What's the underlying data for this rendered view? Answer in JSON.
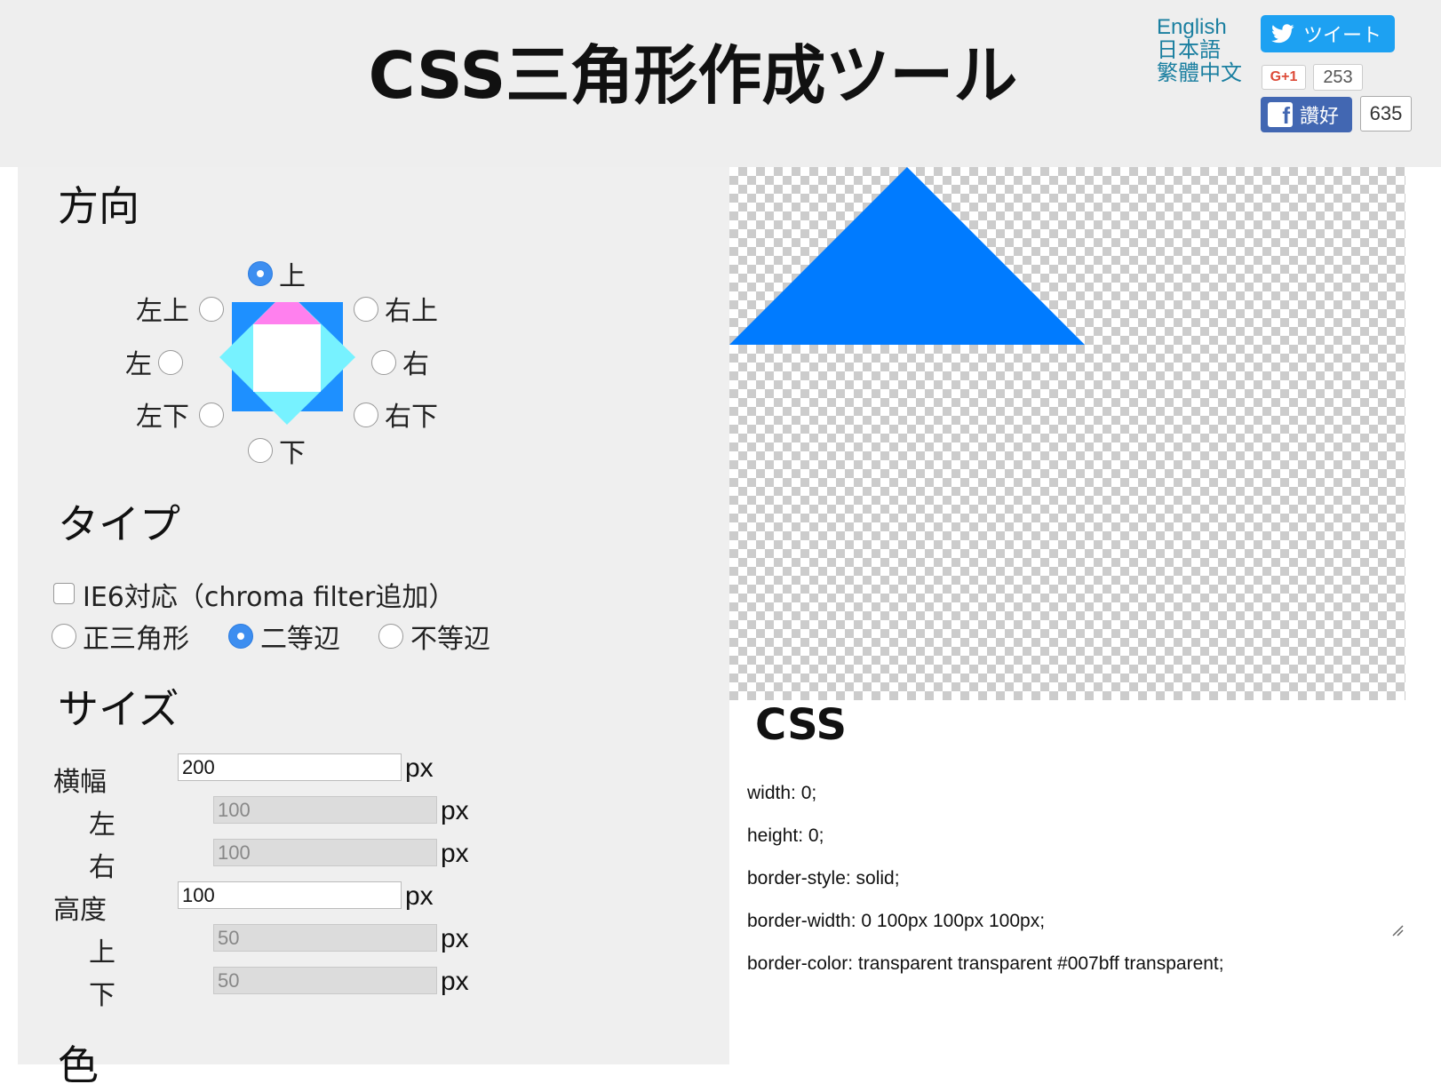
{
  "header": {
    "title": "CSS三角形作成ツール",
    "languages": [
      "English",
      "日本語",
      "繁體中文"
    ],
    "tweet_label": "ツイート",
    "gplus_label": "G+1",
    "gplus_count": "253",
    "fb_label": "讚好",
    "fb_count": "635"
  },
  "direction": {
    "heading": "方向",
    "options": {
      "up": "上",
      "up_left": "左上",
      "up_right": "右上",
      "left": "左",
      "right": "右",
      "down_left": "左下",
      "down_right": "右下",
      "down": "下"
    },
    "selected": "up"
  },
  "type": {
    "heading": "タイプ",
    "ie6_label": "IE6対応（chroma filter追加）",
    "ie6_checked": false,
    "options": {
      "equilateral": "正三角形",
      "isosceles": "二等辺",
      "scalene": "不等辺"
    },
    "selected": "isosceles"
  },
  "size": {
    "heading": "サイズ",
    "width_label": "横幅",
    "width_value": "200",
    "left_label": "左",
    "left_value": "100",
    "right_label": "右",
    "right_value": "100",
    "height_label": "高度",
    "height_value": "100",
    "top_label": "上",
    "top_value": "50",
    "bottom_label": "下",
    "bottom_value": "50",
    "unit": "px"
  },
  "color": {
    "heading": "色"
  },
  "output": {
    "heading": "CSS",
    "lines": [
      "width: 0;",
      "height: 0;",
      "border-style: solid;",
      "border-width: 0 100px 100px 100px;",
      "border-color: transparent transparent #007bff transparent;"
    ]
  },
  "colors": {
    "triangle": "#007bff",
    "diagram_square": "#1e90ff",
    "diagram_diamond": "#77f2ff",
    "diagram_highlight": "#ff80ee"
  }
}
